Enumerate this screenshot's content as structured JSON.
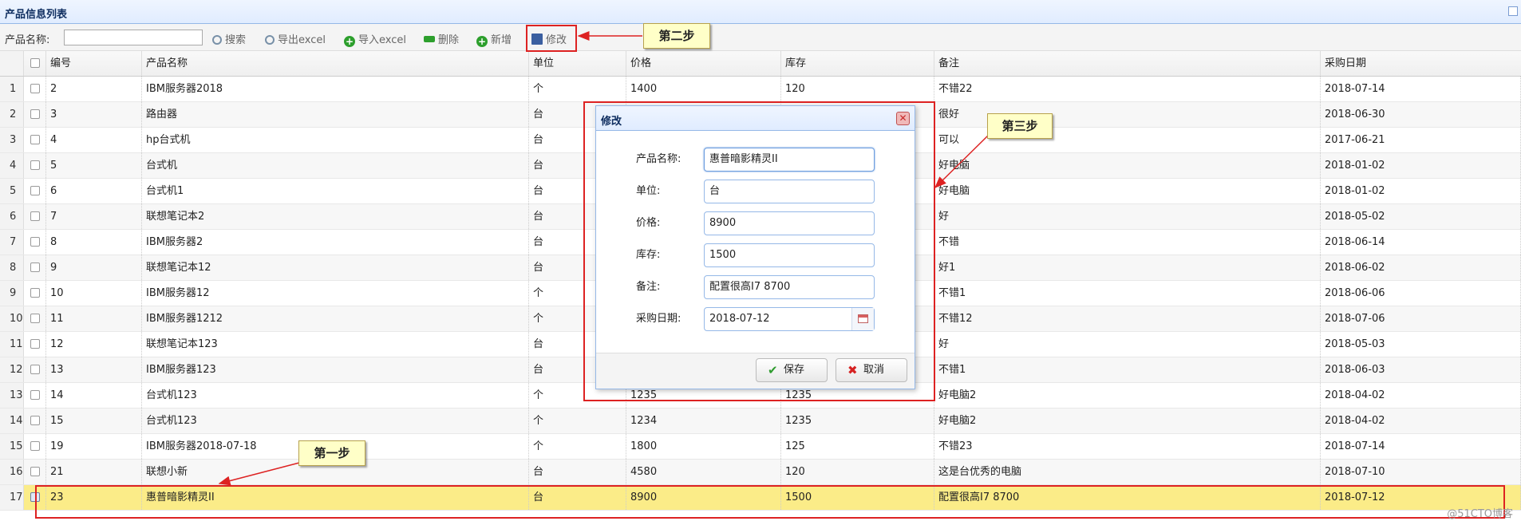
{
  "panel": {
    "title": "产品信息列表"
  },
  "toolbar": {
    "name_label": "产品名称:",
    "search_value": "",
    "buttons": {
      "search": "搜索",
      "export": "导出excel",
      "import": "导入excel",
      "delete": "删除",
      "add": "新增",
      "edit": "修改"
    }
  },
  "grid": {
    "columns": [
      "编号",
      "产品名称",
      "单位",
      "价格",
      "库存",
      "备注",
      "采购日期"
    ],
    "rows": [
      {
        "rn": "1",
        "id": "2",
        "name": "IBM服务器2018",
        "unit": "个",
        "price": "1400",
        "stock": "120",
        "note": "不错22",
        "date": "2018-07-14"
      },
      {
        "rn": "2",
        "id": "3",
        "name": "路由器",
        "unit": "台",
        "price": "",
        "stock": "",
        "note": "很好",
        "date": "2018-06-30"
      },
      {
        "rn": "3",
        "id": "4",
        "name": "hp台式机",
        "unit": "台",
        "price": "",
        "stock": "",
        "note": "可以",
        "date": "2017-06-21"
      },
      {
        "rn": "4",
        "id": "5",
        "name": "台式机",
        "unit": "台",
        "price": "",
        "stock": "",
        "note": "好电脑",
        "date": "2018-01-02"
      },
      {
        "rn": "5",
        "id": "6",
        "name": "台式机1",
        "unit": "台",
        "price": "",
        "stock": "",
        "note": "好电脑",
        "date": "2018-01-02"
      },
      {
        "rn": "6",
        "id": "7",
        "name": "联想笔记本2",
        "unit": "台",
        "price": "",
        "stock": "",
        "note": "好",
        "date": "2018-05-02"
      },
      {
        "rn": "7",
        "id": "8",
        "name": "IBM服务器2",
        "unit": "台",
        "price": "",
        "stock": "",
        "note": "不错",
        "date": "2018-06-14"
      },
      {
        "rn": "8",
        "id": "9",
        "name": "联想笔记本12",
        "unit": "台",
        "price": "",
        "stock": "",
        "note": "好1",
        "date": "2018-06-02"
      },
      {
        "rn": "9",
        "id": "10",
        "name": "IBM服务器12",
        "unit": "个",
        "price": "",
        "stock": "",
        "note": "不错1",
        "date": "2018-06-06"
      },
      {
        "rn": "10",
        "id": "11",
        "name": "IBM服务器1212",
        "unit": "个",
        "price": "",
        "stock": "",
        "note": "不错12",
        "date": "2018-07-06"
      },
      {
        "rn": "11",
        "id": "12",
        "name": "联想笔记本123",
        "unit": "台",
        "price": "",
        "stock": "",
        "note": "好",
        "date": "2018-05-03"
      },
      {
        "rn": "12",
        "id": "13",
        "name": "IBM服务器123",
        "unit": "台",
        "price": "",
        "stock": "",
        "note": "不错1",
        "date": "2018-06-03"
      },
      {
        "rn": "13",
        "id": "14",
        "name": "台式机123",
        "unit": "个",
        "price": "1235",
        "stock": "1235",
        "note": "好电脑2",
        "date": "2018-04-02"
      },
      {
        "rn": "14",
        "id": "15",
        "name": "台式机123",
        "unit": "个",
        "price": "1234",
        "stock": "1235",
        "note": "好电脑2",
        "date": "2018-04-02"
      },
      {
        "rn": "15",
        "id": "19",
        "name": "IBM服务器2018-07-18",
        "unit": "个",
        "price": "1800",
        "stock": "125",
        "note": "不错23",
        "date": "2018-07-14"
      },
      {
        "rn": "16",
        "id": "21",
        "name": "联想小新",
        "unit": "台",
        "price": "4580",
        "stock": "120",
        "note": "这是台优秀的电脑",
        "date": "2018-07-10"
      },
      {
        "rn": "17",
        "id": "23",
        "name": "惠普暗影精灵II",
        "unit": "台",
        "price": "8900",
        "stock": "1500",
        "note": "配置很高I7 8700",
        "date": "2018-07-12"
      }
    ]
  },
  "dialog": {
    "title": "修改",
    "labels": {
      "name": "产品名称:",
      "unit": "单位:",
      "price": "价格:",
      "stock": "库存:",
      "note": "备注:",
      "date": "采购日期:"
    },
    "values": {
      "name": "惠普暗影精灵II",
      "unit": "台",
      "price": "8900",
      "stock": "1500",
      "note": "配置很高I7 8700",
      "date": "2018-07-12"
    },
    "save": "保存",
    "cancel": "取消"
  },
  "callouts": {
    "step1": "第一步",
    "step2": "第二步",
    "step3": "第三步"
  },
  "watermark": "@51CTO博客",
  "colors": {
    "annotation_red": "#d22222",
    "selected_row": "#fbec88",
    "header_blue": "#e0ecff"
  }
}
